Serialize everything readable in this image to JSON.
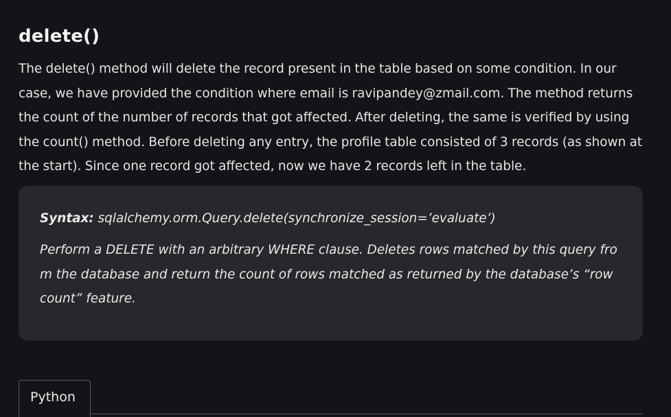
{
  "section": {
    "heading": "delete()",
    "paragraph": "The delete() method will delete the record present in the table based on some condition. In our case, we have provided the condition where email is ravipandey@zmail.com. The method returns the count of the number of records that got affected. After deleting, the same is verified by using the count() method. Before deleting any entry, the profile table consisted of 3 records (as shown at the start). Since one record got affected, now we have 2 records left in the table."
  },
  "syntax_box": {
    "label": "Syntax:",
    "signature": " sqlalchemy.orm.Query.delete(synchronize_session=’evaluate’)",
    "description": "Perform a DELETE with an arbitrary WHERE clause. Deletes rows matched by this query from the database and return the count of rows matched as returned by the database’s “row count” feature."
  },
  "code_tabs": {
    "active_label": "Python"
  },
  "colors": {
    "background": "#131417",
    "box_background": "#27282b",
    "text": "#e6e6e6",
    "tab_border": "#5a5a5c"
  }
}
